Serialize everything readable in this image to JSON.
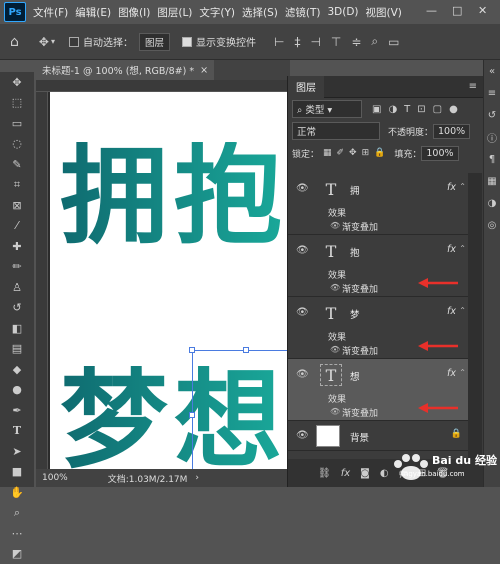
{
  "menubar": {
    "logo": "Ps",
    "items": [
      "文件(F)",
      "编辑(E)",
      "图像(I)",
      "图层(L)",
      "文字(Y)",
      "选择(S)",
      "滤镜(T)",
      "3D(D)",
      "视图(V)"
    ],
    "min": "—",
    "max": "□",
    "close": "✕"
  },
  "options": {
    "home_icon": "home-icon",
    "move_icon": "move-icon",
    "auto_select_label": "自动选择：",
    "auto_select_value": "图层",
    "show_transform_label": "显示变换控件"
  },
  "document": {
    "tab_title": "未标题-1 @ 100% (想, RGB/8#) *",
    "close": "×",
    "row1": "拥抱",
    "row2": "梦想",
    "zoom": "100%",
    "doc_info": "文档:1.03M/2.17M"
  },
  "panel": {
    "tab": "图层",
    "filter_label": "类型",
    "blend_mode": "正常",
    "opacity_label": "不透明度：",
    "opacity_value": "100%",
    "lock_label": "锁定：",
    "fill_label": "填充：",
    "fill_value": "100%",
    "layers": [
      {
        "name": "拥",
        "fx": "fx",
        "effect": "效果",
        "effect_name": "渐变叠加",
        "active": false,
        "arrow": false
      },
      {
        "name": "抱",
        "fx": "fx",
        "effect": "效果",
        "effect_name": "渐变叠加",
        "active": false,
        "arrow": true
      },
      {
        "name": "梦",
        "fx": "fx",
        "effect": "效果",
        "effect_name": "渐变叠加",
        "active": false,
        "arrow": true
      },
      {
        "name": "想",
        "fx": "fx",
        "effect": "效果",
        "effect_name": "渐变叠加",
        "active": true,
        "arrow": true
      }
    ],
    "background": {
      "name": "背景"
    }
  },
  "colors": {
    "gradient_start": "#0f6b70",
    "gradient_end": "#1aa99a",
    "arrow": "#e8302a"
  },
  "watermark": {
    "text": "Bai du 经验",
    "sub": "jingyan.baidu.com"
  }
}
